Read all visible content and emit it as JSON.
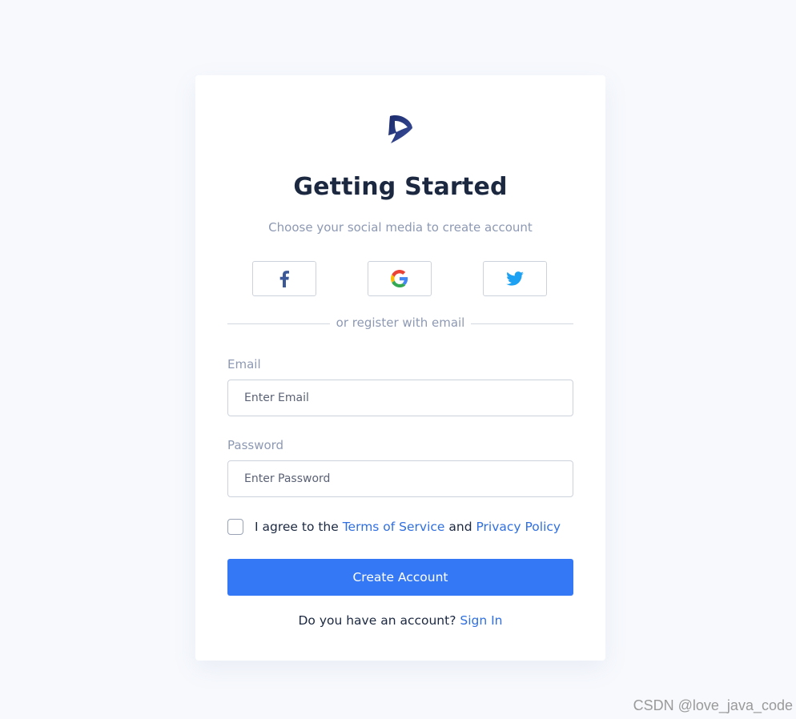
{
  "header": {
    "logo_icon": "brand-d-logo-icon",
    "title": "Getting Started",
    "subtitle": "Choose your social media to create account"
  },
  "social": {
    "buttons": [
      {
        "name": "facebook",
        "icon": "facebook-icon",
        "color": "#3b5998"
      },
      {
        "name": "google",
        "icon": "google-icon",
        "color": "#4285f4"
      },
      {
        "name": "twitter",
        "icon": "twitter-icon",
        "color": "#1da1f2"
      }
    ]
  },
  "divider": {
    "text": "or register with email"
  },
  "form": {
    "email": {
      "label": "Email",
      "placeholder": "Enter Email",
      "value": ""
    },
    "password": {
      "label": "Password",
      "placeholder": "Enter Password",
      "value": ""
    },
    "agree": {
      "checked": false,
      "prefix": "I agree to the ",
      "terms_link": "Terms of Service",
      "conjunction": " and ",
      "privacy_link": "Privacy Policy"
    },
    "submit_label": "Create Account"
  },
  "footer": {
    "prompt": "Do you have an account? ",
    "signin_link": "Sign In"
  },
  "watermark": "CSDN @love_java_code",
  "colors": {
    "background": "#f7f9fd",
    "primary": "#3478f6",
    "link": "#2f6fe0",
    "heading": "#1b2840",
    "muted": "#8d99b3"
  }
}
